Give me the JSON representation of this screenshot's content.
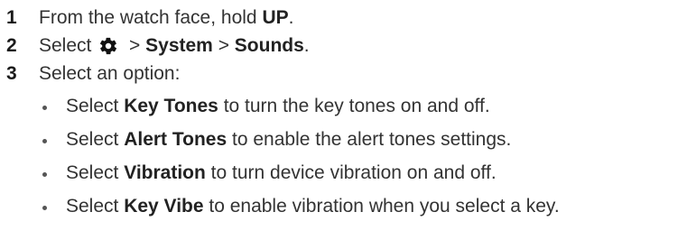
{
  "steps": [
    {
      "number": "1",
      "pre": "From the watch face, hold ",
      "bold": "UP",
      "post": "."
    },
    {
      "number": "2",
      "pre": "Select ",
      "icon": "gear-icon",
      "sep1": " > ",
      "bold1": "System",
      "sep2": " > ",
      "bold2": "Sounds",
      "post": "."
    },
    {
      "number": "3",
      "text": "Select an option:"
    }
  ],
  "options": [
    {
      "pre": "Select ",
      "bold": "Key Tones",
      "post": " to turn the key tones on and off."
    },
    {
      "pre": "Select ",
      "bold": "Alert Tones",
      "post": " to enable the alert tones settings."
    },
    {
      "pre": "Select ",
      "bold": "Vibration",
      "post": " to turn device vibration on and off."
    },
    {
      "pre": "Select ",
      "bold": "Key Vibe",
      "post": " to enable vibration when you select a key."
    }
  ]
}
